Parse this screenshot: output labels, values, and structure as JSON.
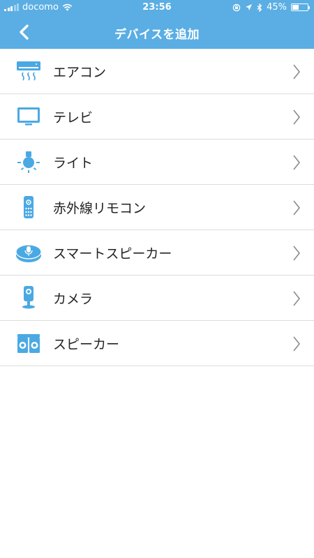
{
  "status_bar": {
    "carrier": "docomo",
    "time": "23:56",
    "battery_percent": "45%",
    "battery_level": 0.45
  },
  "nav": {
    "title": "デバイスを追加",
    "back_icon": "chevron-left-icon"
  },
  "colors": {
    "accent": "#5aaee3",
    "icon": "#4aa9e3",
    "divider": "#dcdcdc",
    "text": "#222222"
  },
  "devices": [
    {
      "label": "エアコン",
      "icon": "air-conditioner-icon"
    },
    {
      "label": "テレビ",
      "icon": "tv-icon"
    },
    {
      "label": "ライト",
      "icon": "light-bulb-icon"
    },
    {
      "label": "赤外線リモコン",
      "icon": "ir-remote-icon"
    },
    {
      "label": "スマートスピーカー",
      "icon": "smart-speaker-icon"
    },
    {
      "label": "カメラ",
      "icon": "camera-icon"
    },
    {
      "label": "スピーカー",
      "icon": "speaker-icon"
    }
  ]
}
